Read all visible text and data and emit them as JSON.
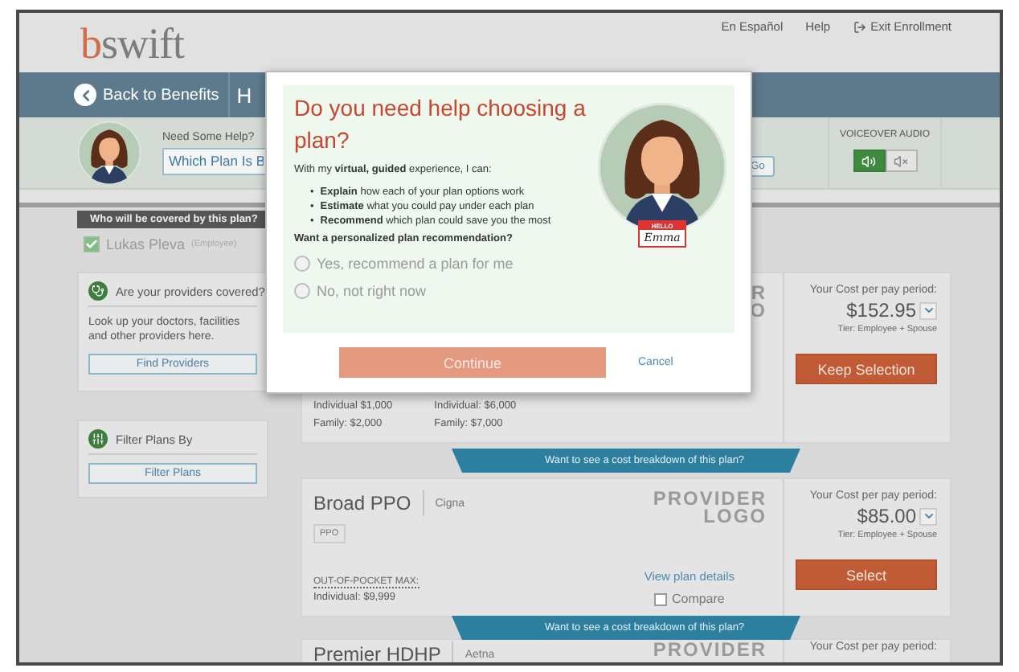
{
  "header": {
    "logo": "bswift",
    "links": [
      {
        "kind": "text",
        "label": "En Español"
      },
      {
        "kind": "text",
        "label": "Help"
      },
      {
        "kind": "exit",
        "label": "Exit Enrollment"
      }
    ]
  },
  "nav": {
    "back": "Back to Benefits",
    "current": "H"
  },
  "help": {
    "label": "Need Some Help?",
    "search_value": "Which Plan Is B",
    "go": "Go"
  },
  "voiceover": {
    "label": "VOICEOVER AUDIO",
    "options": [
      {
        "kind": "sound",
        "selected": true
      },
      {
        "kind": "mute",
        "selected": false
      }
    ]
  },
  "coverage": {
    "title": "Who will be covered by this plan?",
    "members": [
      {
        "name": "Lukas Pleva",
        "role": "(Employee)",
        "checked": true
      }
    ]
  },
  "providers_card": {
    "title": "Are your providers covered?",
    "text": "Look up your doctors, facilities and other providers here.",
    "button": "Find Providers"
  },
  "filter_card": {
    "title": "Filter Plans By",
    "button": "Filter Plans"
  },
  "plans": [
    {
      "logo": [
        "R",
        "O"
      ],
      "deductibles": [
        [
          "Individual $1,000",
          "Family: $2,000"
        ],
        [
          "Individual: $6,000",
          "Family: $7,000"
        ]
      ],
      "cost_label": "Your Cost per pay period:",
      "price": "$152.95",
      "tier": "Tier: Employee + Spouse",
      "action": "Keep Selection",
      "banner": "Want to see a cost breakdown of this plan?"
    },
    {
      "name": "Broad PPO",
      "carrier": "Cigna",
      "tag": "PPO",
      "max_label": "OUT-OF-POCKET MAX:",
      "max_value": "Individual: $9,999",
      "logo": [
        "PROVIDER",
        "LOGO"
      ],
      "details_link": "View plan details",
      "compare": {
        "label": "Compare",
        "checked": false
      },
      "cost_label": "Your Cost per pay period:",
      "price": "$85.00",
      "tier": "Tier: Employee + Spouse",
      "action": "Select",
      "banner": "Want to see a cost breakdown of this plan?"
    },
    {
      "name": "Premier HDHP",
      "carrier": "Aetna",
      "logo": [
        "PROVIDER"
      ],
      "cost_label": "Your Cost per pay period:"
    }
  ],
  "modal": {
    "title": "Do you need help choosing a plan?",
    "intro": "With my **virtual, guided** experience, I can:",
    "bullet_marker": "•",
    "bullets": [
      "**Explain** how each of your plan options work",
      "**Estimate** what you could pay under each plan",
      "**Recommend** which plan could save you the most"
    ],
    "question": "Want a personalized plan recommendation?",
    "options": [
      {
        "label": "Yes, recommend a plan for me",
        "selected": false
      },
      {
        "label": "No, not right now",
        "selected": false
      }
    ],
    "badge": {
      "top": "HELLO",
      "name": "Emma"
    },
    "continue": {
      "label": "Continue",
      "disabled": true
    },
    "cancel": "Cancel"
  }
}
